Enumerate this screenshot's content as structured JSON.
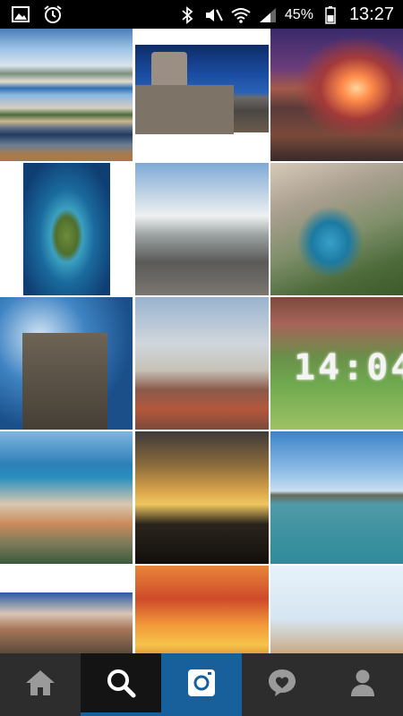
{
  "status_bar": {
    "left_icons": [
      "image-notification-icon",
      "alarm-clock-icon"
    ],
    "right_icons": [
      "bluetooth-icon",
      "mute-icon",
      "wifi-icon",
      "signal-icon",
      "battery-icon"
    ],
    "battery": "45%",
    "time": "13:27"
  },
  "grid": {
    "tiles": [
      {
        "subject": "seaside-promenade-palms"
      },
      {
        "subject": "fortress-tower-at-dusk"
      },
      {
        "subject": "old-town-rooftops-sunset"
      },
      {
        "subject": "heart-shaped-island"
      },
      {
        "subject": "street-with-power-lines"
      },
      {
        "subject": "canyon-river"
      },
      {
        "subject": "castle-tower"
      },
      {
        "subject": "city-rooftops"
      },
      {
        "subject": "park-with-digital-clock",
        "overlay_text": "14:04"
      },
      {
        "subject": "coastal-road-tilt-shift"
      },
      {
        "subject": "sunset-silhouettes"
      },
      {
        "subject": "lake-horizon"
      },
      {
        "subject": "campers-at-beach"
      },
      {
        "subject": "orange-sunset-over-sea"
      },
      {
        "subject": "seaside-town-bell-tower"
      }
    ]
  },
  "bottom_nav": {
    "items": [
      "home-icon",
      "search-icon",
      "camera-icon",
      "activity-heart-icon",
      "profile-icon"
    ],
    "active": "search-icon",
    "accent": "#17609c"
  }
}
